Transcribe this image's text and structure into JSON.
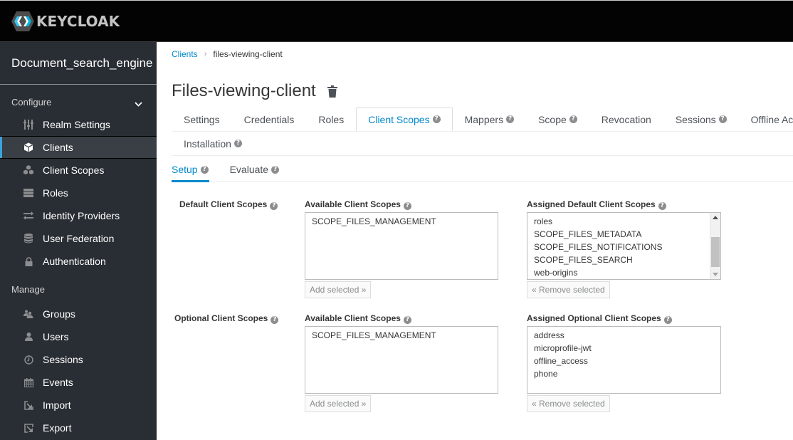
{
  "app": {
    "logo_text": "KEYCLOAK",
    "brand_color": "#39a5dc"
  },
  "sidebar": {
    "realm_name": "Document_search_engine",
    "configure": {
      "title": "Configure",
      "items": [
        {
          "label": "Realm Settings",
          "icon": "sliders-icon"
        },
        {
          "label": "Clients",
          "icon": "cube-icon",
          "active": true
        },
        {
          "label": "Client Scopes",
          "icon": "cubes-icon"
        },
        {
          "label": "Roles",
          "icon": "server-icon"
        },
        {
          "label": "Identity Providers",
          "icon": "exchange-icon"
        },
        {
          "label": "User Federation",
          "icon": "database-icon"
        },
        {
          "label": "Authentication",
          "icon": "lock-icon"
        }
      ]
    },
    "manage": {
      "title": "Manage",
      "items": [
        {
          "label": "Groups",
          "icon": "users-icon"
        },
        {
          "label": "Users",
          "icon": "user-icon"
        },
        {
          "label": "Sessions",
          "icon": "clock-icon"
        },
        {
          "label": "Events",
          "icon": "calendar-icon"
        },
        {
          "label": "Import",
          "icon": "import-icon"
        },
        {
          "label": "Export",
          "icon": "export-icon"
        }
      ]
    }
  },
  "breadcrumb": {
    "parent": "Clients",
    "separator": "›",
    "current": "files-viewing-client"
  },
  "page": {
    "title": "Files-viewing-client"
  },
  "tabs": [
    {
      "label": "Settings",
      "help": false
    },
    {
      "label": "Credentials",
      "help": false
    },
    {
      "label": "Roles",
      "help": false
    },
    {
      "label": "Client Scopes",
      "help": true,
      "active": true
    },
    {
      "label": "Mappers",
      "help": true
    },
    {
      "label": "Scope",
      "help": true
    },
    {
      "label": "Revocation",
      "help": false
    },
    {
      "label": "Sessions",
      "help": true
    },
    {
      "label": "Offline Access",
      "help": true
    },
    {
      "label": "Installation",
      "help": true
    }
  ],
  "subtabs": [
    {
      "label": "Setup",
      "active": true
    },
    {
      "label": "Evaluate",
      "active": false
    }
  ],
  "help_glyph": "?",
  "default_scopes": {
    "group_label": "Default Client Scopes",
    "available_label": "Available Client Scopes",
    "available": [
      "SCOPE_FILES_MANAGEMENT"
    ],
    "add_button": "Add selected »",
    "assigned_label": "Assigned Default Client Scopes",
    "assigned": [
      "roles",
      "SCOPE_FILES_METADATA",
      "SCOPE_FILES_NOTIFICATIONS",
      "SCOPE_FILES_SEARCH",
      "web-origins"
    ],
    "remove_button": "« Remove selected"
  },
  "optional_scopes": {
    "group_label": "Optional Client Scopes",
    "available_label": "Available Client Scopes",
    "available": [
      "SCOPE_FILES_MANAGEMENT"
    ],
    "add_button": "Add selected »",
    "assigned_label": "Assigned Optional Client Scopes",
    "assigned": [
      "address",
      "microprofile-jwt",
      "offline_access",
      "phone"
    ],
    "remove_button": "« Remove selected"
  }
}
